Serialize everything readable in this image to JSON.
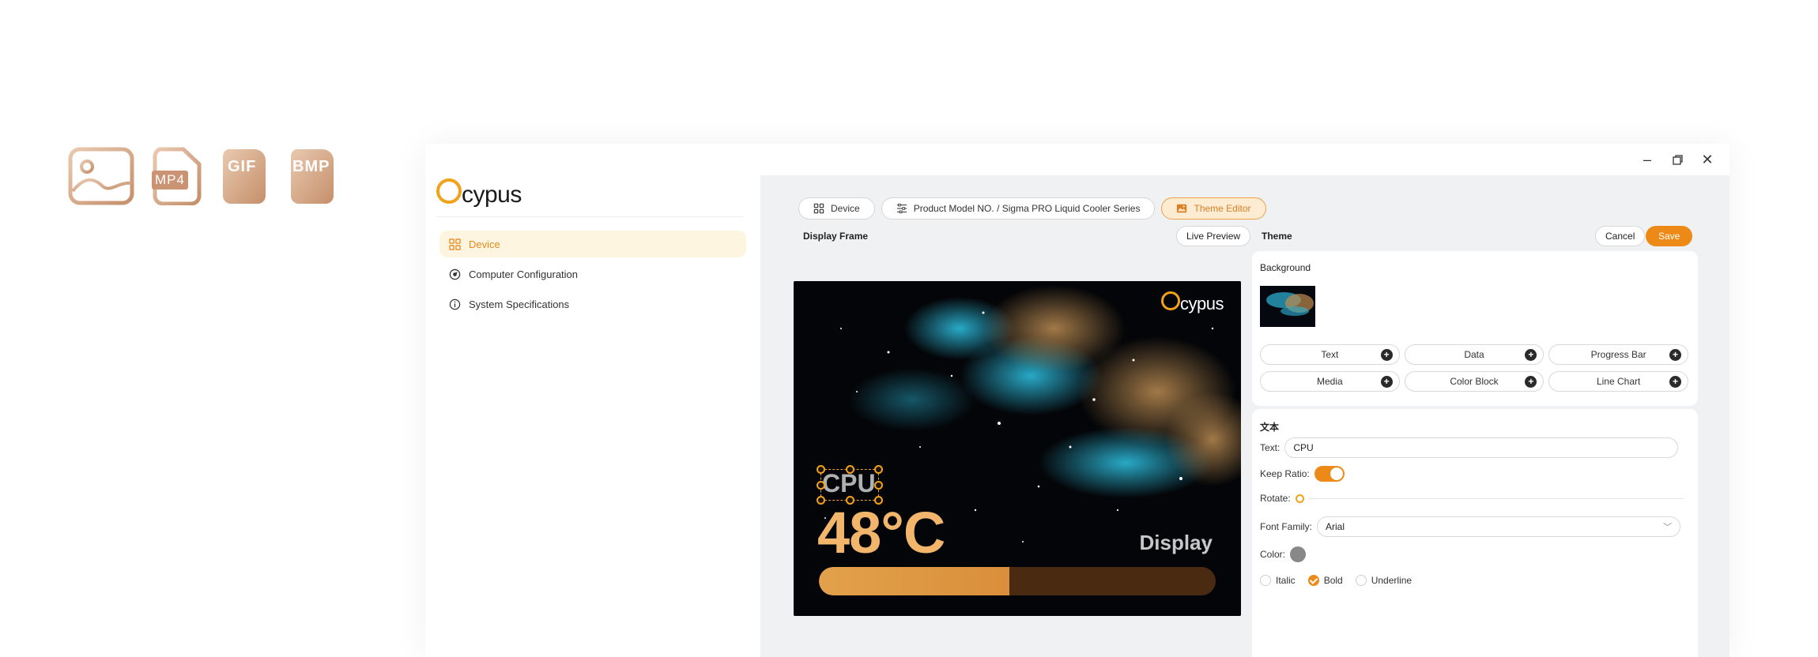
{
  "file_types": [
    "MP4",
    "GIF",
    "BMP"
  ],
  "brand": {
    "logo_text": "cypus",
    "accent": "#ed8a17"
  },
  "sidebar": {
    "items": [
      {
        "label": "Device",
        "icon": "grid-icon",
        "active": true
      },
      {
        "label": "Computer Configuration",
        "icon": "dial-icon",
        "active": false
      },
      {
        "label": "System Specifications",
        "icon": "info-icon",
        "active": false
      }
    ]
  },
  "tabs": [
    {
      "label": "Device",
      "icon": "grid-icon"
    },
    {
      "label": "Product Model NO. / Sigma PRO Liquid Cooler Series",
      "icon": "sliders-icon"
    },
    {
      "label": "Theme Editor",
      "icon": "image-icon",
      "active": true
    }
  ],
  "display_frame": {
    "title": "Display Frame",
    "live_preview": "Live Preview",
    "logo_text": "cypus",
    "cpu_label": "CPU",
    "temperature": "48°C",
    "display_word": "Display",
    "progress": 0.48
  },
  "theme": {
    "title": "Theme",
    "cancel": "Cancel",
    "save": "Save",
    "background_label": "Background",
    "tools": [
      "Text",
      "Data",
      "Progress Bar",
      "Media",
      "Color Block",
      "Line Chart"
    ],
    "text_section": "文本",
    "text_label": "Text:",
    "text_value": "CPU",
    "keep_ratio_label": "Keep Ratio:",
    "rotate_label": "Rotate:",
    "font_family_label": "Font Family:",
    "font_family_value": "Arial",
    "color_label": "Color:",
    "styles": [
      {
        "label": "Italic",
        "checked": false
      },
      {
        "label": "Bold",
        "checked": true
      },
      {
        "label": "Underline",
        "checked": false
      }
    ]
  }
}
